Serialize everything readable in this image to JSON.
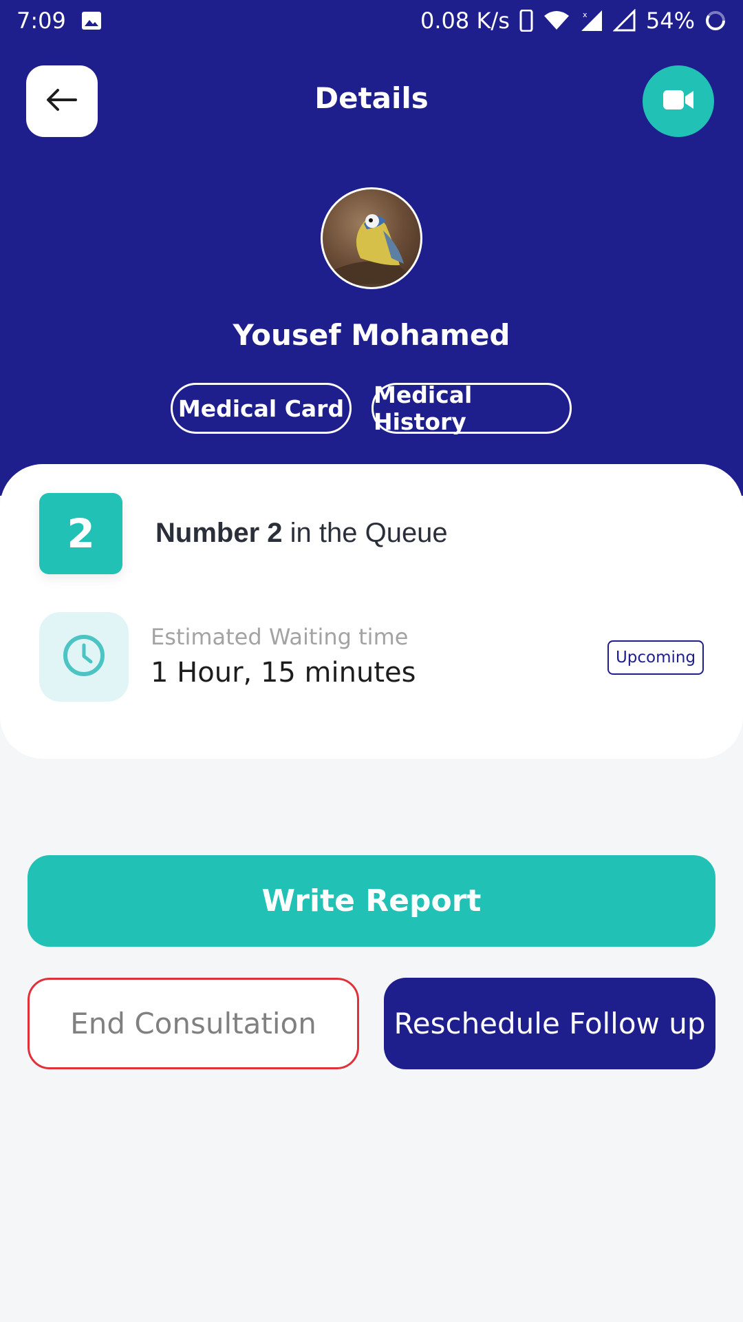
{
  "status_bar": {
    "time": "7:09",
    "speed": "0.08 K/s",
    "battery": "54%",
    "icons": [
      "image-icon",
      "phone-icon",
      "wifi-icon",
      "signal-icon",
      "signal-empty-icon",
      "battery-ring-icon"
    ]
  },
  "header": {
    "title": "Details",
    "back_icon": "arrow-left-icon",
    "video_icon": "video-camera-icon"
  },
  "patient": {
    "name": "Yousef Mohamed",
    "chips": {
      "card": "Medical Card",
      "history": "Medical History"
    }
  },
  "queue": {
    "number": "2",
    "text_bold": "Number 2",
    "text_rest": " in the Queue"
  },
  "waiting": {
    "label": "Estimated Waiting time",
    "value": "1 Hour, 15 minutes",
    "status": "Upcoming",
    "icon": "clock-icon"
  },
  "actions": {
    "write_report": "Write Report",
    "end_consultation": "End Consultation",
    "reschedule": "Reschedule Follow up"
  },
  "colors": {
    "primary": "#1e1e8c",
    "accent": "#22c1b6",
    "danger": "#e0313a"
  }
}
